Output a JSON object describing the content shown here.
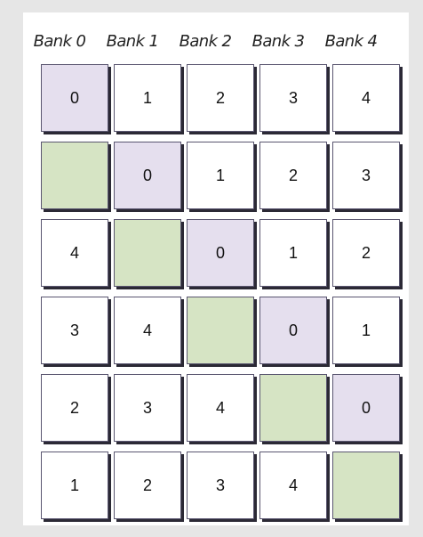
{
  "headers": [
    "Bank 0",
    "Bank 1",
    "Bank 2",
    "Bank 3",
    "Bank 4"
  ],
  "colors": {
    "background": "#e6e6e6",
    "panel": "#ffffff",
    "purple": "#e5dfee",
    "green": "#d6e4c4",
    "white": "#ffffff"
  },
  "rows": [
    [
      {
        "v": "0",
        "c": "purple"
      },
      {
        "v": "1",
        "c": "white"
      },
      {
        "v": "2",
        "c": "white"
      },
      {
        "v": "3",
        "c": "white"
      },
      {
        "v": "4",
        "c": "white"
      }
    ],
    [
      {
        "v": "",
        "c": "green"
      },
      {
        "v": "0",
        "c": "purple"
      },
      {
        "v": "1",
        "c": "white"
      },
      {
        "v": "2",
        "c": "white"
      },
      {
        "v": "3",
        "c": "white"
      }
    ],
    [
      {
        "v": "4",
        "c": "white"
      },
      {
        "v": "",
        "c": "green"
      },
      {
        "v": "0",
        "c": "purple"
      },
      {
        "v": "1",
        "c": "white"
      },
      {
        "v": "2",
        "c": "white"
      }
    ],
    [
      {
        "v": "3",
        "c": "white"
      },
      {
        "v": "4",
        "c": "white"
      },
      {
        "v": "",
        "c": "green"
      },
      {
        "v": "0",
        "c": "purple"
      },
      {
        "v": "1",
        "c": "white"
      }
    ],
    [
      {
        "v": "2",
        "c": "white"
      },
      {
        "v": "3",
        "c": "white"
      },
      {
        "v": "4",
        "c": "white"
      },
      {
        "v": "",
        "c": "green"
      },
      {
        "v": "0",
        "c": "purple"
      }
    ],
    [
      {
        "v": "1",
        "c": "white"
      },
      {
        "v": "2",
        "c": "white"
      },
      {
        "v": "3",
        "c": "white"
      },
      {
        "v": "4",
        "c": "white"
      },
      {
        "v": "",
        "c": "green"
      }
    ]
  ]
}
